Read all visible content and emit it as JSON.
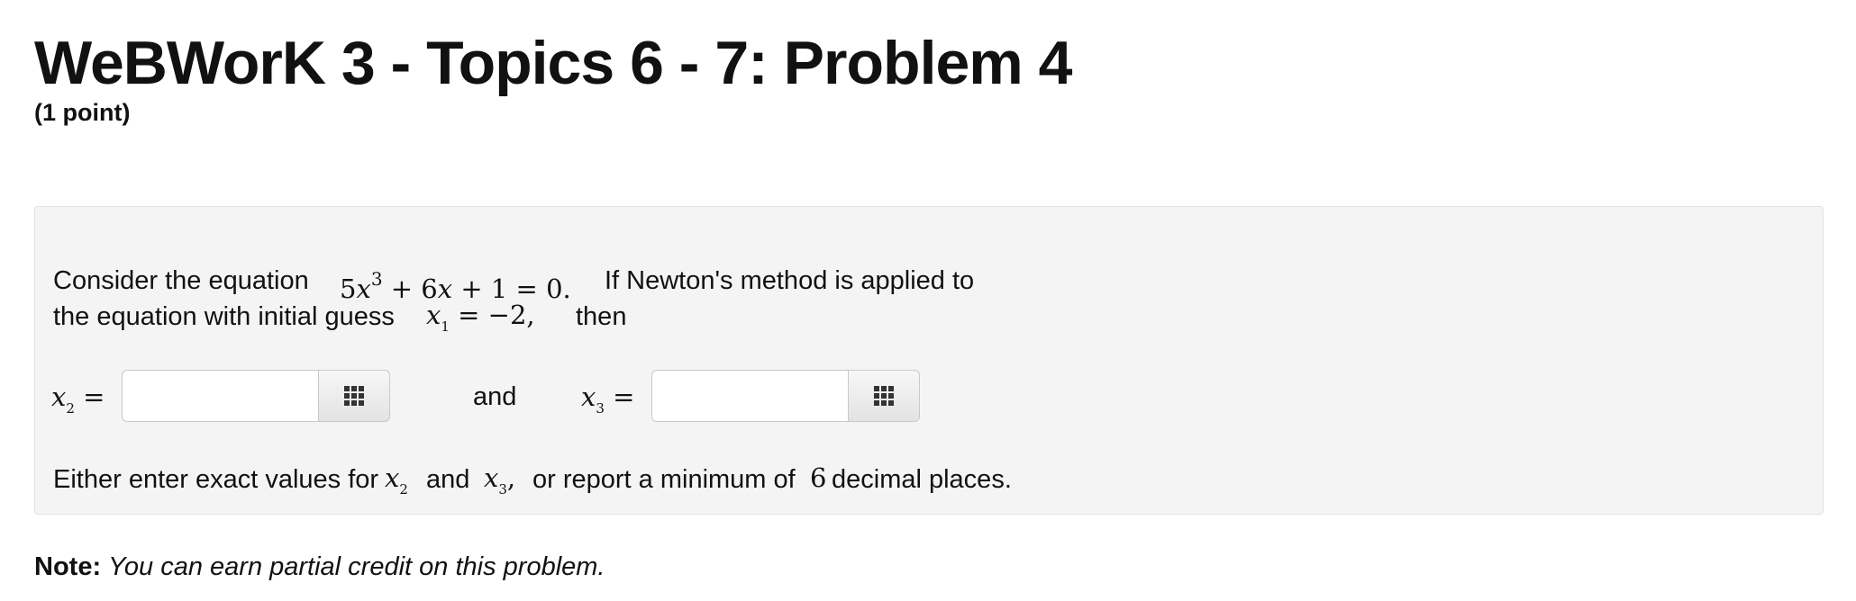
{
  "header": {
    "title": "WeBWorK 3 - Topics 6 - 7: Problem 4",
    "points": "(1 point)"
  },
  "problem": {
    "intro": "Consider the equation",
    "equation": {
      "coef1": "5",
      "var": "x",
      "exp": "3",
      "op1": " + ",
      "coef2": "6",
      "op2": " + ",
      "const": "1",
      "eq": " = ",
      "rhs": "0."
    },
    "intro_after": "If Newton's method is applied to",
    "line2_text": "the equation with initial guess",
    "initial": {
      "var": "x",
      "sub": "1",
      "rest": " = −2,"
    },
    "then": "then",
    "answers": [
      {
        "var": "x",
        "sub": "2",
        "eq": " =",
        "value": "",
        "placeholder": ""
      },
      {
        "var": "x",
        "sub": "3",
        "eq": " =",
        "value": "",
        "placeholder": ""
      }
    ],
    "and_label": "and",
    "hint": {
      "part1": "Either enter exact values for",
      "var_a": "x",
      "sub_a": "2",
      "and": "and",
      "var_b": "x",
      "sub_b": "3",
      "comma": ",",
      "part2": "or report a minimum of",
      "digits": "6",
      "part3": "decimal places."
    }
  },
  "note": {
    "label": "Note:",
    "text": "You can earn partial credit on this problem."
  },
  "icons": {
    "equation_editor": "grid-icon"
  }
}
